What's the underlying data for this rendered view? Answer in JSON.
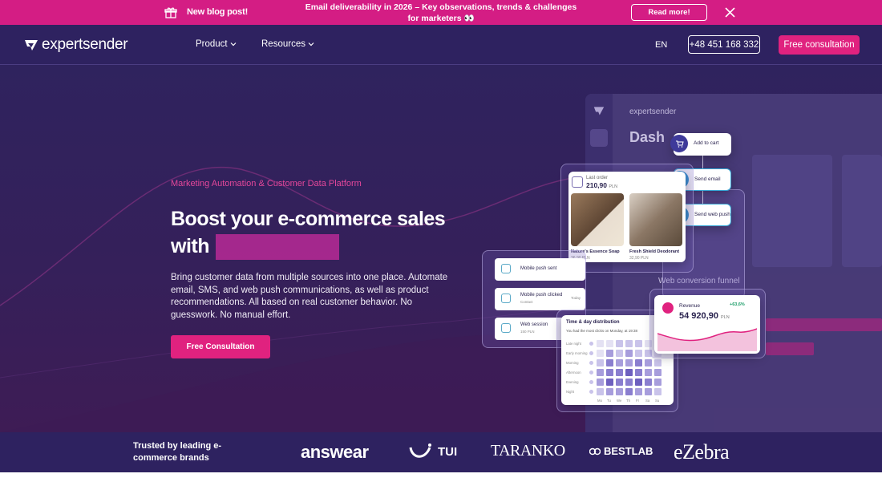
{
  "announcement": {
    "new_post": "New blog post!",
    "message": "Email deliverability in 2026 – Key observations, trends & challenges for marketers 👀",
    "read_more": "Read more!"
  },
  "header": {
    "logo_text": "expertsender",
    "nav": [
      {
        "label": "Product"
      },
      {
        "label": "Resources"
      }
    ],
    "language": "EN",
    "phone": "+48 451 168 332",
    "cta": "Free consultation"
  },
  "hero": {
    "eyebrow": "Marketing Automation & Customer Data Platform",
    "headline_line1": "Boost your e-commerce sales",
    "headline_line2": "with",
    "description": "Bring customer data from multiple sources into one place. Automate email, SMS, and web push communications, as well as product recommendations. All based on real customer behavior. No guesswork. No manual effort.",
    "cta": "Free Consultation"
  },
  "mockup": {
    "brand": "expertsender",
    "dashboard_title": "Dash",
    "funnel_title": "Web conversion funnel",
    "last_order": {
      "label": "Last order",
      "amount": "210,90",
      "currency": "PLN",
      "products": [
        {
          "name": "Nature's Essence Soap",
          "price": "36,90 PLN"
        },
        {
          "name": "Fresh Shield Deodorant",
          "price": "32,90 PLN"
        }
      ]
    },
    "flow": [
      {
        "label": "Add to cart"
      },
      {
        "label": "Send email"
      },
      {
        "label": "Send web push"
      }
    ],
    "push_events": [
      {
        "title": "Mobile push sent",
        "sub": ""
      },
      {
        "title": "Mobile push clicked",
        "sub": "Contact",
        "time": "Today"
      },
      {
        "title": "Web session",
        "sub": "150 PLN"
      }
    ],
    "heatmap": {
      "title": "Time & day distribution",
      "subtitle": "You had the most clicks on Monday, at 19:38",
      "rows": [
        "Late night",
        "Early morning",
        "Morning",
        "Afternoon",
        "Evening",
        "Night"
      ],
      "days": [
        "Mo",
        "Tu",
        "We",
        "Th",
        "Fr",
        "Sa",
        "Su"
      ]
    },
    "revenue": {
      "label": "Revenue",
      "change": "+63,6%",
      "amount": "54 920,90",
      "currency": "PLN"
    }
  },
  "brands": {
    "trusted": "Trusted by leading e-commerce brands",
    "logos": [
      "answear",
      "TUI",
      "TARANKO",
      "BESTLAB",
      "eZebra"
    ]
  },
  "colors": {
    "accent": "#e0227f",
    "announce_bg": "#d41d84",
    "header_bg": "#2e2260",
    "hero_bg": "#32215c"
  }
}
